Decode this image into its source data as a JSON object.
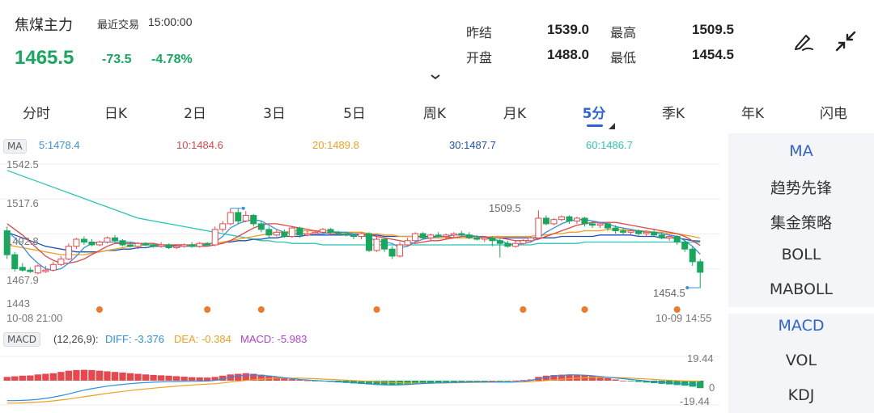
{
  "header": {
    "title": "焦煤主力",
    "last_trade_label": "最近交易",
    "last_trade_time": "15:00:00",
    "price": "1465.5",
    "change": "-73.5",
    "change_pct": "-4.78%",
    "stats": {
      "prev_settle_label": "昨结",
      "prev_settle": "1539.0",
      "high_label": "最高",
      "high": "1509.5",
      "open_label": "开盘",
      "open": "1488.0",
      "low_label": "最低",
      "low": "1454.5"
    }
  },
  "tabs": [
    "分时",
    "日K",
    "2日",
    "3日",
    "5日",
    "周K",
    "月K",
    "5分",
    "季K",
    "年K",
    "闪电"
  ],
  "active_tab": "5分",
  "ma": {
    "tag": "MA",
    "values": [
      {
        "label": "5:1478.4",
        "color": "#3b8fe0"
      },
      {
        "label": "10:1484.6",
        "color": "#e0454a"
      },
      {
        "label": "20:1489.8",
        "color": "#f0a020"
      },
      {
        "label": "30:1487.7",
        "color": "#1f4fb5"
      },
      {
        "label": "60:1486.7",
        "color": "#2cc4b4"
      }
    ]
  },
  "price_axis": [
    "1542.5",
    "1517.6",
    "1492.8",
    "1467.9",
    "1443"
  ],
  "high_marker": "1509.5",
  "low_marker": "1454.5",
  "time_start": "10-08 21:00",
  "time_end": "10-09 14:55",
  "macd": {
    "tag": "MACD",
    "params": "(12,26,9):",
    "diff": "DIFF: -3.376",
    "dea": "DEA: -0.384",
    "macd": "MACD: -5.983",
    "diff_color": "#2b8fe0",
    "dea_color": "#f0a020",
    "macd_color": "#b43fd9",
    "axis_top": "19.44",
    "axis_zero": "0",
    "axis_bottom": "-19.44"
  },
  "side_panel": {
    "indicators_top": [
      "MA",
      "趋势先锋",
      "集金策略",
      "BOLL",
      "MABOLL"
    ],
    "indicators_bottom": [
      "MACD",
      "VOL",
      "KDJ"
    ]
  },
  "colors": {
    "up": "#e8474d",
    "down": "#17a85d",
    "accent": "#2d62d9",
    "event_dot": "#f07a2a"
  },
  "chart_data": {
    "type": "candlestick",
    "ylim": [
      1443,
      1542.5
    ],
    "candles": [
      [
        1495,
        1478,
        1498,
        1475
      ],
      [
        1478,
        1468,
        1480,
        1466
      ],
      [
        1469,
        1467,
        1472,
        1466
      ],
      [
        1467,
        1466,
        1469,
        1465
      ],
      [
        1465,
        1470,
        1471,
        1464
      ],
      [
        1466,
        1467,
        1470,
        1465
      ],
      [
        1467,
        1471,
        1473,
        1466
      ],
      [
        1471,
        1475,
        1477,
        1470
      ],
      [
        1475,
        1484,
        1486,
        1474
      ],
      [
        1484,
        1489,
        1490,
        1482
      ],
      [
        1489,
        1487,
        1491,
        1485
      ],
      [
        1487,
        1485,
        1489,
        1484
      ],
      [
        1485,
        1487,
        1488,
        1484
      ],
      [
        1487,
        1490,
        1491,
        1486
      ],
      [
        1490,
        1488,
        1492,
        1487
      ],
      [
        1488,
        1485,
        1489,
        1484
      ],
      [
        1485,
        1484,
        1487,
        1483
      ],
      [
        1484,
        1486,
        1487,
        1482
      ],
      [
        1486,
        1485,
        1487,
        1484
      ],
      [
        1485,
        1484,
        1486,
        1483
      ],
      [
        1484,
        1485,
        1487,
        1483
      ],
      [
        1485,
        1483,
        1486,
        1482
      ],
      [
        1483,
        1484,
        1485,
        1482
      ],
      [
        1484,
        1485,
        1486,
        1483
      ],
      [
        1485,
        1484,
        1487,
        1483
      ],
      [
        1484,
        1486,
        1487,
        1483
      ],
      [
        1486,
        1485,
        1487,
        1484
      ],
      [
        1485,
        1496,
        1498,
        1484
      ],
      [
        1496,
        1500,
        1502,
        1494
      ],
      [
        1500,
        1508,
        1511,
        1499
      ],
      [
        1508,
        1502,
        1511,
        1500
      ],
      [
        1502,
        1506,
        1509,
        1501
      ],
      [
        1506,
        1500,
        1507,
        1498
      ],
      [
        1500,
        1496,
        1502,
        1494
      ],
      [
        1496,
        1492,
        1498,
        1490
      ],
      [
        1492,
        1494,
        1496,
        1491
      ],
      [
        1494,
        1491,
        1496,
        1490
      ],
      [
        1491,
        1497,
        1498,
        1490
      ],
      [
        1497,
        1492,
        1498,
        1490
      ],
      [
        1492,
        1493,
        1495,
        1491
      ],
      [
        1493,
        1494,
        1495,
        1492
      ],
      [
        1494,
        1496,
        1497,
        1493
      ],
      [
        1496,
        1494,
        1497,
        1493
      ],
      [
        1494,
        1493,
        1495,
        1492
      ],
      [
        1493,
        1492,
        1494,
        1491
      ],
      [
        1492,
        1491,
        1493,
        1489
      ],
      [
        1491,
        1493,
        1494,
        1489
      ],
      [
        1493,
        1481,
        1494,
        1480
      ],
      [
        1481,
        1489,
        1491,
        1480
      ],
      [
        1489,
        1482,
        1490,
        1480
      ],
      [
        1482,
        1477,
        1484,
        1475
      ],
      [
        1477,
        1485,
        1487,
        1476
      ],
      [
        1485,
        1488,
        1490,
        1484
      ],
      [
        1488,
        1493,
        1494,
        1487
      ],
      [
        1493,
        1490,
        1494,
        1489
      ],
      [
        1490,
        1492,
        1493,
        1488
      ],
      [
        1492,
        1491,
        1494,
        1490
      ],
      [
        1491,
        1492,
        1493,
        1489
      ],
      [
        1492,
        1493,
        1494,
        1490
      ],
      [
        1493,
        1492,
        1495,
        1491
      ],
      [
        1492,
        1490,
        1494,
        1489
      ],
      [
        1490,
        1489,
        1492,
        1488
      ],
      [
        1489,
        1490,
        1491,
        1487
      ],
      [
        1490,
        1488,
        1491,
        1484
      ],
      [
        1488,
        1486,
        1490,
        1476
      ],
      [
        1486,
        1484,
        1488,
        1483
      ],
      [
        1484,
        1486,
        1488,
        1483
      ],
      [
        1486,
        1488,
        1489,
        1485
      ],
      [
        1488,
        1490,
        1491,
        1487
      ],
      [
        1490,
        1504,
        1509.5,
        1489
      ],
      [
        1504,
        1500,
        1506,
        1499
      ],
      [
        1500,
        1503,
        1504,
        1499
      ],
      [
        1503,
        1505,
        1506,
        1502
      ],
      [
        1505,
        1502,
        1506,
        1500
      ],
      [
        1502,
        1504,
        1505,
        1500
      ],
      [
        1504,
        1500,
        1505,
        1498
      ],
      [
        1500,
        1499,
        1502,
        1497
      ],
      [
        1499,
        1500,
        1501,
        1497
      ],
      [
        1500,
        1497,
        1501,
        1495
      ],
      [
        1497,
        1495,
        1499,
        1493
      ],
      [
        1495,
        1494,
        1497,
        1492
      ],
      [
        1494,
        1495,
        1496,
        1492
      ],
      [
        1495,
        1493,
        1496,
        1491
      ],
      [
        1493,
        1494,
        1495,
        1491
      ],
      [
        1494,
        1492,
        1496,
        1491
      ],
      [
        1492,
        1490,
        1494,
        1489
      ],
      [
        1490,
        1491,
        1492,
        1488
      ],
      [
        1491,
        1487,
        1492,
        1485
      ],
      [
        1487,
        1482,
        1489,
        1480
      ],
      [
        1482,
        1473,
        1484,
        1470
      ],
      [
        1473,
        1465.5,
        1475,
        1454.5
      ]
    ],
    "ma5": [
      1495,
      1490,
      1484,
      1477,
      1472,
      1468,
      1467,
      1468,
      1472,
      1477,
      1483,
      1486,
      1487,
      1487,
      1487,
      1487,
      1487,
      1486,
      1485,
      1485,
      1484,
      1484,
      1484,
      1484,
      1484,
      1484,
      1485,
      1487,
      1491,
      1497,
      1500,
      1502,
      1503,
      1502,
      1499,
      1496,
      1494,
      1493,
      1493,
      1493,
      1493,
      1493,
      1494,
      1494,
      1494,
      1493,
      1492,
      1490,
      1488,
      1487,
      1486,
      1483,
      1484,
      1487,
      1489,
      1490,
      1491,
      1491,
      1492,
      1492,
      1492,
      1491,
      1490,
      1489,
      1488,
      1486,
      1485,
      1486,
      1487,
      1490,
      1494,
      1497,
      1500,
      1502,
      1503,
      1503,
      1502,
      1501,
      1500,
      1498,
      1497,
      1496,
      1495,
      1494,
      1494,
      1493,
      1492,
      1491,
      1488,
      1484,
      1478.4
    ],
    "ma10": [
      1500,
      1496,
      1492,
      1487,
      1482,
      1477,
      1474,
      1472,
      1472,
      1473,
      1475,
      1478,
      1481,
      1484,
      1486,
      1486,
      1486,
      1486,
      1486,
      1486,
      1485,
      1485,
      1485,
      1485,
      1484,
      1484,
      1484,
      1485,
      1486,
      1488,
      1491,
      1494,
      1497,
      1499,
      1500,
      1500,
      1499,
      1498,
      1497,
      1496,
      1495,
      1494,
      1493,
      1493,
      1493,
      1493,
      1493,
      1492,
      1491,
      1490,
      1489,
      1488,
      1487,
      1486,
      1487,
      1488,
      1488,
      1489,
      1490,
      1491,
      1491,
      1491,
      1491,
      1490,
      1490,
      1489,
      1488,
      1488,
      1488,
      1489,
      1491,
      1493,
      1495,
      1497,
      1499,
      1500,
      1501,
      1501,
      1501,
      1501,
      1500,
      1499,
      1498,
      1497,
      1496,
      1495,
      1494,
      1493,
      1491,
      1488,
      1484.6
    ],
    "ma20": [
      1485,
      1484,
      1483,
      1482,
      1481,
      1480,
      1479,
      1478,
      1478,
      1478,
      1478,
      1479,
      1480,
      1481,
      1482,
      1483,
      1484,
      1484,
      1485,
      1485,
      1485,
      1485,
      1485,
      1485,
      1485,
      1486,
      1486,
      1486,
      1487,
      1488,
      1489,
      1490,
      1491,
      1492,
      1493,
      1494,
      1494,
      1495,
      1495,
      1495,
      1495,
      1495,
      1495,
      1494,
      1494,
      1494,
      1494,
      1493,
      1493,
      1492,
      1492,
      1491,
      1491,
      1491,
      1490,
      1490,
      1490,
      1490,
      1490,
      1490,
      1490,
      1490,
      1490,
      1491,
      1491,
      1491,
      1491,
      1491,
      1491,
      1492,
      1492,
      1493,
      1493,
      1494,
      1494,
      1495,
      1495,
      1495,
      1496,
      1496,
      1496,
      1495,
      1495,
      1495,
      1494,
      1494,
      1493,
      1493,
      1492,
      1491,
      1489.8
    ],
    "ma30": [
      1494,
      1492,
      1490,
      1488,
      1486,
      1484,
      1483,
      1482,
      1481,
      1480,
      1480,
      1480,
      1480,
      1481,
      1481,
      1482,
      1482,
      1483,
      1483,
      1484,
      1484,
      1484,
      1485,
      1485,
      1485,
      1485,
      1486,
      1486,
      1487,
      1487,
      1488,
      1488,
      1489,
      1489,
      1490,
      1490,
      1491,
      1491,
      1491,
      1492,
      1492,
      1492,
      1492,
      1492,
      1492,
      1492,
      1492,
      1492,
      1492,
      1491,
      1491,
      1491,
      1491,
      1491,
      1491,
      1491,
      1491,
      1491,
      1490,
      1490,
      1490,
      1490,
      1490,
      1490,
      1490,
      1490,
      1490,
      1490,
      1490,
      1490,
      1490,
      1490,
      1491,
      1491,
      1491,
      1491,
      1491,
      1492,
      1492,
      1492,
      1492,
      1492,
      1491,
      1491,
      1491,
      1490,
      1490,
      1490,
      1489,
      1488,
      1487.7
    ],
    "ma60": [
      1538,
      1536,
      1534,
      1532,
      1530,
      1528,
      1526,
      1524,
      1522,
      1520,
      1518,
      1516,
      1514,
      1512,
      1510,
      1508,
      1506,
      1504,
      1503,
      1502,
      1501,
      1500,
      1499,
      1498,
      1497,
      1496,
      1495,
      1494,
      1493,
      1492,
      1491,
      1490,
      1489,
      1488,
      1488,
      1487,
      1487,
      1486,
      1486,
      1486,
      1486,
      1485,
      1485,
      1485,
      1485,
      1485,
      1485,
      1485,
      1485,
      1485,
      1485,
      1485,
      1485,
      1485,
      1485,
      1485,
      1485,
      1485,
      1485,
      1485,
      1485,
      1485,
      1485,
      1485,
      1485,
      1485,
      1485,
      1485,
      1485,
      1486,
      1486,
      1486,
      1486,
      1486,
      1486,
      1487,
      1487,
      1487,
      1487,
      1487,
      1487,
      1487,
      1487,
      1487,
      1487,
      1487,
      1487,
      1487,
      1487,
      1487,
      1486.7
    ],
    "event_dots": [
      12,
      26,
      33,
      48,
      67,
      75,
      87
    ],
    "macd_hist": [
      3,
      3.5,
      4,
      4.2,
      5,
      5.5,
      6,
      7,
      8,
      8.5,
      8.7,
      8.5,
      8,
      7.5,
      7,
      6.5,
      6,
      5.5,
      5,
      4.6,
      4.3,
      4,
      3.6,
      3.2,
      2.8,
      2.6,
      2.5,
      3,
      4,
      5,
      5.5,
      6,
      5.5,
      4.8,
      4,
      3,
      2,
      1.2,
      0.6,
      0.2,
      -0.2,
      -0.6,
      -1,
      -1.4,
      -1.8,
      -2.2,
      -2.6,
      -3,
      -3.4,
      -3.6,
      -3.8,
      -3.5,
      -3,
      -2.6,
      -2.2,
      -1.8,
      -1.5,
      -1.2,
      -1,
      -0.8,
      -0.6,
      -0.4,
      -0.2,
      0,
      -0.1,
      -0.2,
      0.2,
      0.5,
      1,
      3,
      4,
      4.5,
      4.8,
      5,
      4.6,
      4.2,
      3.8,
      3,
      2,
      1,
      0,
      -0.5,
      -1,
      -1.5,
      -2,
      -2.5,
      -3,
      -3.5,
      -4,
      -4.8,
      -5.983
    ],
    "diff": [
      -16,
      -16,
      -15.8,
      -15.5,
      -15,
      -14.2,
      -13.2,
      -12,
      -10.6,
      -9,
      -7.6,
      -6.4,
      -5.4,
      -4.4,
      -3.6,
      -3,
      -2.4,
      -1.9,
      -1.5,
      -1.2,
      -1,
      -0.8,
      -0.7,
      -0.6,
      -0.5,
      -0.4,
      -0.3,
      0.2,
      1.4,
      2.8,
      3.8,
      4.4,
      4.6,
      4.3,
      3.8,
      3.2,
      2.4,
      1.6,
      1,
      0.6,
      0.2,
      -0.2,
      -0.6,
      -0.9,
      -1.2,
      -1.6,
      -2,
      -2.6,
      -3,
      -3.3,
      -3.5,
      -3.4,
      -3.1,
      -2.7,
      -2.3,
      -2,
      -1.8,
      -1.6,
      -1.4,
      -1.2,
      -1.1,
      -1,
      -1,
      -1,
      -1.1,
      -1.2,
      -1,
      -0.6,
      0.2,
      1.6,
      2.8,
      3.6,
      4.2,
      4.6,
      4.6,
      4.4,
      4,
      3.4,
      2.8,
      2.2,
      1.6,
      1,
      0.4,
      -0.2,
      -0.8,
      -1.4,
      -1.9,
      -2.3,
      -2.7,
      -3.1,
      -3.376
    ],
    "dea": [
      -18,
      -18,
      -17.8,
      -17.5,
      -17.2,
      -16.8,
      -16.2,
      -15.5,
      -14.7,
      -13.8,
      -12.9,
      -12,
      -11.1,
      -10.2,
      -9.4,
      -8.6,
      -7.9,
      -7.2,
      -6.6,
      -6,
      -5.4,
      -4.9,
      -4.4,
      -3.9,
      -3.5,
      -3.1,
      -2.8,
      -2.4,
      -1.8,
      -1.1,
      -0.4,
      0.2,
      0.8,
      1.3,
      1.7,
      2,
      2.1,
      2.1,
      2,
      1.8,
      1.6,
      1.3,
      1,
      0.7,
      0.4,
      0.1,
      -0.2,
      -0.5,
      -0.8,
      -1.1,
      -1.4,
      -1.7,
      -1.9,
      -2,
      -2,
      -2,
      -1.9,
      -1.8,
      -1.7,
      -1.6,
      -1.5,
      -1.4,
      -1.3,
      -1.2,
      -1.2,
      -1.2,
      -1.1,
      -1,
      -0.8,
      -0.4,
      0.1,
      0.6,
      1.1,
      1.6,
      2,
      2.3,
      2.5,
      2.6,
      2.6,
      2.5,
      2.3,
      2,
      1.7,
      1.4,
      1,
      0.6,
      0.3,
      0,
      -0.2,
      -0.3,
      -0.384
    ],
    "macd_ylim": [
      -19.44,
      19.44
    ]
  }
}
